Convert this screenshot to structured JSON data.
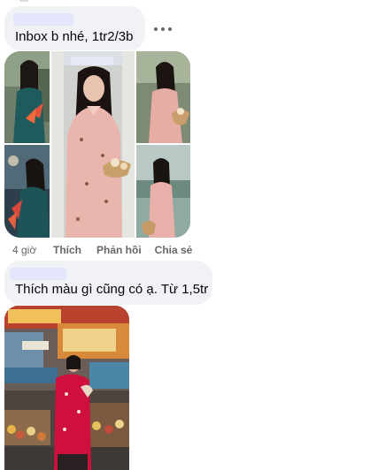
{
  "comments": [
    {
      "text": "Inbox b nhé, 1tr2/3b"
    },
    {
      "text": "Thích màu gì cũng có ạ. Từ 1,5tr"
    }
  ],
  "actions": {
    "time": "4 giờ",
    "like": "Thích",
    "reply": "Phản hồi",
    "share": "Chia sẻ"
  },
  "icons": {
    "more": "more-horizontal-icon"
  },
  "colors": {
    "bubble": "#f0f2f5",
    "text": "#050505",
    "secondary": "#65676b",
    "dress_pink": "#e9b5ad",
    "dress_teal": "#1f5a5c",
    "dress_red": "#d0103c"
  }
}
